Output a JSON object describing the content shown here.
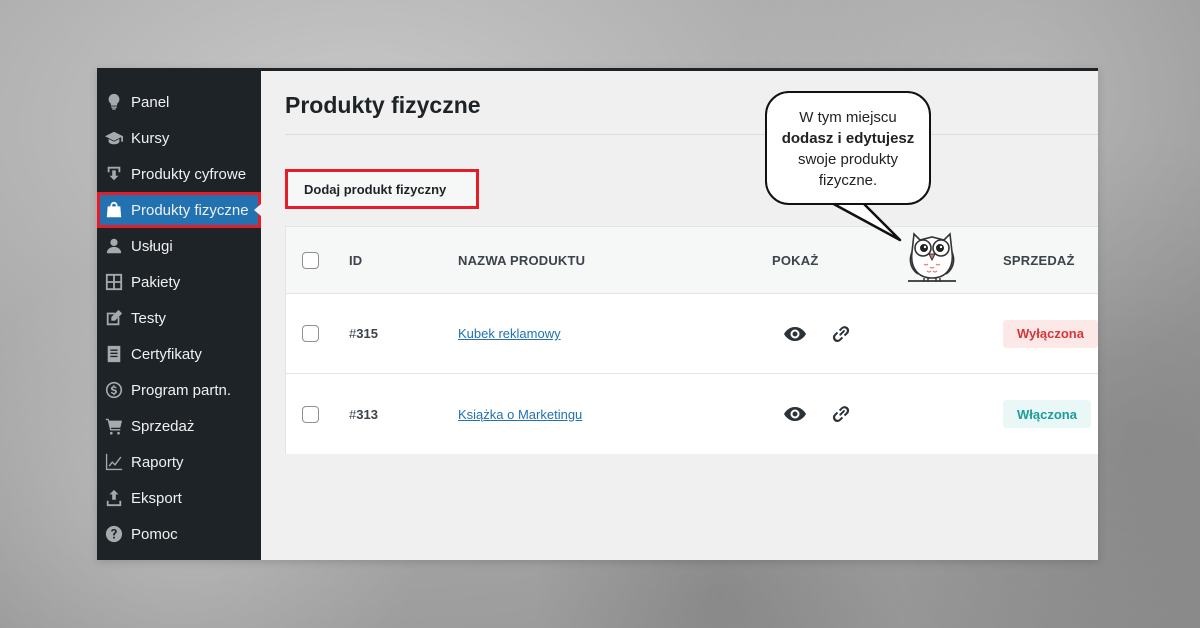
{
  "sidebar": {
    "items": [
      {
        "label": "Panel",
        "icon": "lightbulb-icon"
      },
      {
        "label": "Kursy",
        "icon": "graduation-cap-icon"
      },
      {
        "label": "Produkty cyfrowe",
        "icon": "download-icon"
      },
      {
        "label": "Produkty fizyczne",
        "icon": "shopping-bag-icon",
        "active": true
      },
      {
        "label": "Usługi",
        "icon": "person-icon"
      },
      {
        "label": "Pakiety",
        "icon": "grid-icon"
      },
      {
        "label": "Testy",
        "icon": "edit-icon"
      },
      {
        "label": "Certyfikaty",
        "icon": "document-icon"
      },
      {
        "label": "Program partn.",
        "icon": "dollar-icon"
      },
      {
        "label": "Sprzedaż",
        "icon": "cart-icon"
      },
      {
        "label": "Raporty",
        "icon": "chart-icon"
      },
      {
        "label": "Eksport",
        "icon": "upload-icon"
      },
      {
        "label": "Pomoc",
        "icon": "help-icon"
      }
    ]
  },
  "main": {
    "title": "Produkty fizyczne",
    "add_button_label": "Dodaj produkt fizyczny"
  },
  "table": {
    "headers": {
      "id": "ID",
      "name": "NAZWA PRODUKTU",
      "show": "POKAŻ",
      "sale": "SPRZEDAŻ"
    },
    "rows": [
      {
        "id_prefix": "#",
        "id": "315",
        "name": "Kubek reklamowy",
        "status": "Wyłączona",
        "status_type": "off"
      },
      {
        "id_prefix": "#",
        "id": "313",
        "name": "Książka o Marketingu",
        "status": "Włączona",
        "status_type": "on"
      }
    ]
  },
  "callout": {
    "line1": "W tym miejscu",
    "line2": "dodasz i edytujesz",
    "line3": "swoje produkty",
    "line4": "fizyczne."
  },
  "colors": {
    "sidebar_bg": "#1d2327",
    "active_bg": "#2271b1",
    "highlight_red": "#e51d2a",
    "link": "#2271b1",
    "badge_off": "#d63638",
    "badge_on": "#1c9d9a"
  }
}
